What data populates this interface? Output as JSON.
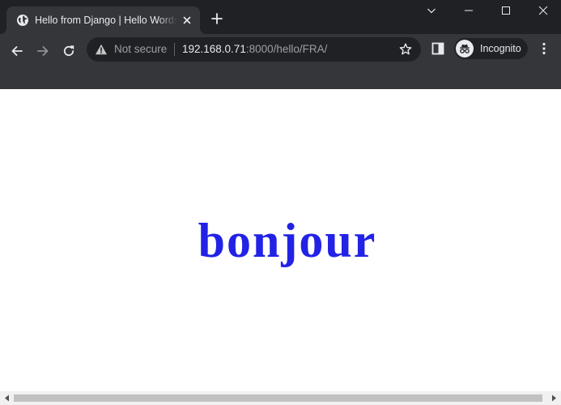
{
  "tab": {
    "title": "Hello from Django | Hello Words"
  },
  "toolbar": {
    "security_label": "Not secure",
    "url_host": "192.168.0.71",
    "url_rest": ":8000/hello/FRA/",
    "profile_label": "Incognito"
  },
  "page": {
    "greeting": "bonjour"
  },
  "colors": {
    "chrome_dark": "#202124",
    "chrome_toolbar": "#35363a",
    "greeting_text": "#2222e6"
  },
  "icons": {
    "favicon": "globe-icon",
    "tab_close": "close-icon",
    "new_tab": "plus-icon",
    "back": "arrow-left-icon",
    "forward": "arrow-right-icon",
    "reload": "reload-icon",
    "security": "warning-icon",
    "bookmark": "star-icon",
    "side_panel": "side-panel-icon",
    "profile": "incognito-icon",
    "menu": "kebab-menu-icon"
  }
}
